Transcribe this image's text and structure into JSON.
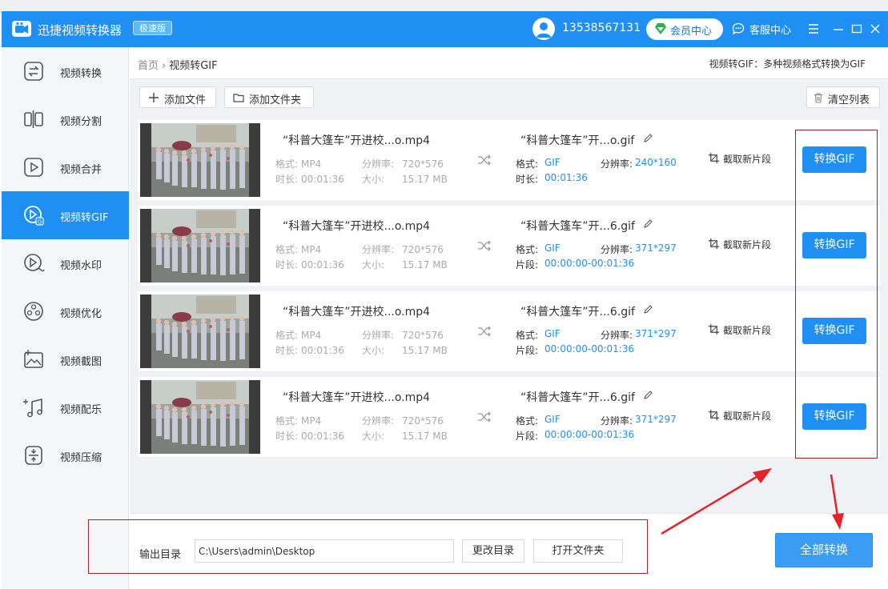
{
  "app": {
    "name": "迅捷视频转换器",
    "edition": "极速版",
    "phone": "13538567131",
    "vip_label": "会员中心",
    "service_label": "客服中心"
  },
  "sidebar": {
    "items": [
      {
        "label": "视频转换",
        "icon": "video-convert-icon",
        "active": false
      },
      {
        "label": "视频分割",
        "icon": "video-split-icon",
        "active": false
      },
      {
        "label": "视频合并",
        "icon": "video-merge-icon",
        "active": false
      },
      {
        "label": "视频转GIF",
        "icon": "video-to-gif-icon",
        "active": true
      },
      {
        "label": "视频水印",
        "icon": "video-watermark-icon",
        "active": false
      },
      {
        "label": "视频优化",
        "icon": "video-optimize-icon",
        "active": false
      },
      {
        "label": "视频截图",
        "icon": "video-screenshot-icon",
        "active": false
      },
      {
        "label": "视频配乐",
        "icon": "video-music-icon",
        "active": false
      },
      {
        "label": "视频压缩",
        "icon": "video-compress-icon",
        "active": false
      }
    ]
  },
  "header": {
    "breadcrumb_home": "首页",
    "breadcrumb_sep": "›",
    "breadcrumb_current": "视频转GIF",
    "description": "视频转GIF：多种视频格式转换为GIF"
  },
  "toolbar": {
    "add_file": "添加文件",
    "add_folder": "添加文件夹",
    "clear_list": "清空列表"
  },
  "labels": {
    "format": "格式:",
    "resolution": "分辨率:",
    "duration": "时长:",
    "size": "大小:",
    "segment": "片段:",
    "clip": "截取新片段",
    "convert": "转换GIF"
  },
  "files": [
    {
      "src_name": "“科普大篷车”开进校...o.mp4",
      "src_format": "MP4",
      "src_resolution": "720*576",
      "src_duration": "00:01:36",
      "src_size": "15.17 MB",
      "out_name": "“科普大篷车”开...o.gif",
      "out_format": "GIF",
      "out_resolution": "240*160",
      "out_time_label": "时长:",
      "out_time": "00:01:36"
    },
    {
      "src_name": "“科普大篷车”开进校...o.mp4",
      "src_format": "MP4",
      "src_resolution": "720*576",
      "src_duration": "00:01:36",
      "src_size": "15.17 MB",
      "out_name": "“科普大篷车”开...6.gif",
      "out_format": "GIF",
      "out_resolution": "371*297",
      "out_time_label": "片段:",
      "out_time": "00:00:00-00:01:36"
    },
    {
      "src_name": "“科普大篷车”开进校...o.mp4",
      "src_format": "MP4",
      "src_resolution": "720*576",
      "src_duration": "00:01:36",
      "src_size": "15.17 MB",
      "out_name": "“科普大篷车”开...6.gif",
      "out_format": "GIF",
      "out_resolution": "371*297",
      "out_time_label": "片段:",
      "out_time": "00:00:00-00:01:36"
    },
    {
      "src_name": "“科普大篷车”开进校...o.mp4",
      "src_format": "MP4",
      "src_resolution": "720*576",
      "src_duration": "00:01:36",
      "src_size": "15.17 MB",
      "out_name": "“科普大篷车”开...6.gif",
      "out_format": "GIF",
      "out_resolution": "371*297",
      "out_time_label": "片段:",
      "out_time": "00:00:00-00:01:36"
    }
  ],
  "output": {
    "label": "输出目录",
    "path": "C:\\Users\\admin\\Desktop",
    "change_dir": "更改目录",
    "open_folder": "打开文件夹",
    "convert_all": "全部转换"
  },
  "colors": {
    "primary": "#1f8ff3",
    "annotation": "#e2252b"
  }
}
